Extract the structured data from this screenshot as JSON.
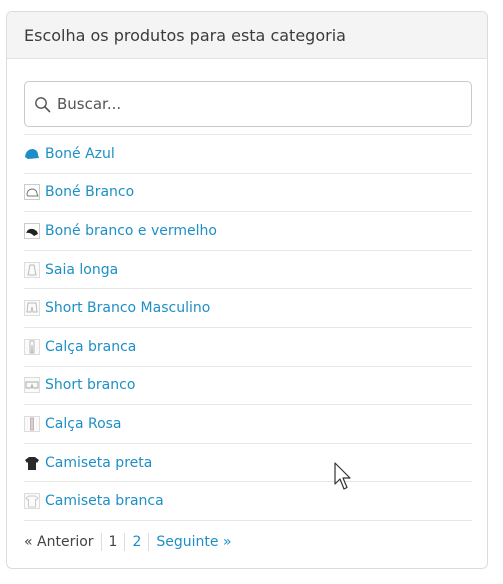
{
  "panel": {
    "title": "Escolha os produtos para esta categoria"
  },
  "search": {
    "placeholder": "Buscar..."
  },
  "products": [
    {
      "name": "Boné Azul",
      "thumb": "blue-cap-icon"
    },
    {
      "name": "Boné Branco",
      "thumb": "white-cap-icon"
    },
    {
      "name": "Boné branco e vermelho",
      "thumb": "black-cap-icon"
    },
    {
      "name": "Saia longa",
      "thumb": "skirt-icon"
    },
    {
      "name": "Short Branco Masculino",
      "thumb": "shorts-icon"
    },
    {
      "name": "Calça branca",
      "thumb": "pants-icon"
    },
    {
      "name": "Short branco",
      "thumb": "shorts-icon"
    },
    {
      "name": "Calça Rosa",
      "thumb": "pants-icon"
    },
    {
      "name": "Camiseta preta",
      "thumb": "black-tshirt-icon"
    },
    {
      "name": "Camiseta branca",
      "thumb": "white-tshirt-icon"
    }
  ],
  "pagination": {
    "prev": "« Anterior",
    "page1": "1",
    "page2": "2",
    "next": "Seguinte »"
  },
  "colors": {
    "link": "#1d8fc6",
    "header_bg": "#f4f4f4"
  }
}
